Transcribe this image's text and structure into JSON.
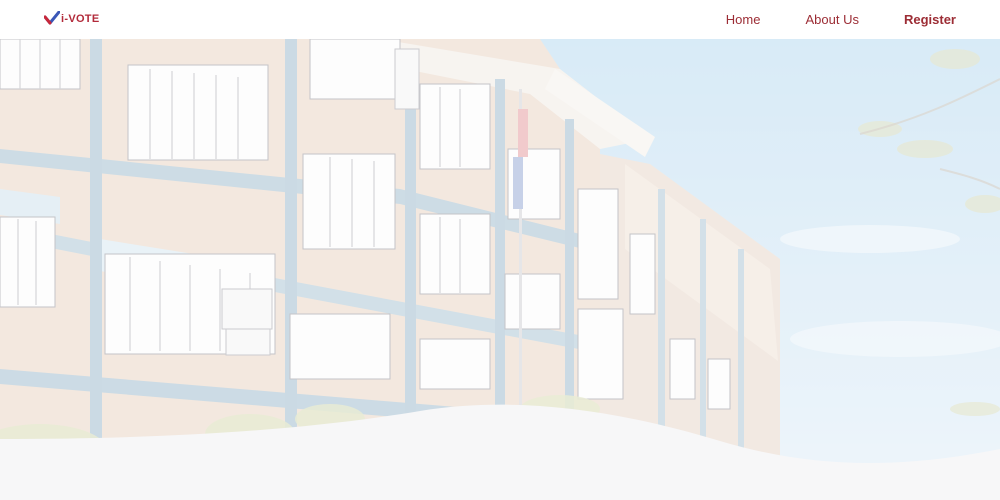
{
  "brand": {
    "name": "i-VOTE",
    "logo_icon": "check-vote-icon",
    "color": "#b22a3a"
  },
  "nav": {
    "home": "Home",
    "about": "About Us",
    "register": "Register"
  },
  "hero": {
    "image": "school-building-photo",
    "overlay": "white-wave"
  },
  "colors": {
    "accent": "#9c2d35",
    "sky": "#cfe6f5",
    "wall": "#e9d9cb",
    "frame": "#b9cfdc"
  }
}
